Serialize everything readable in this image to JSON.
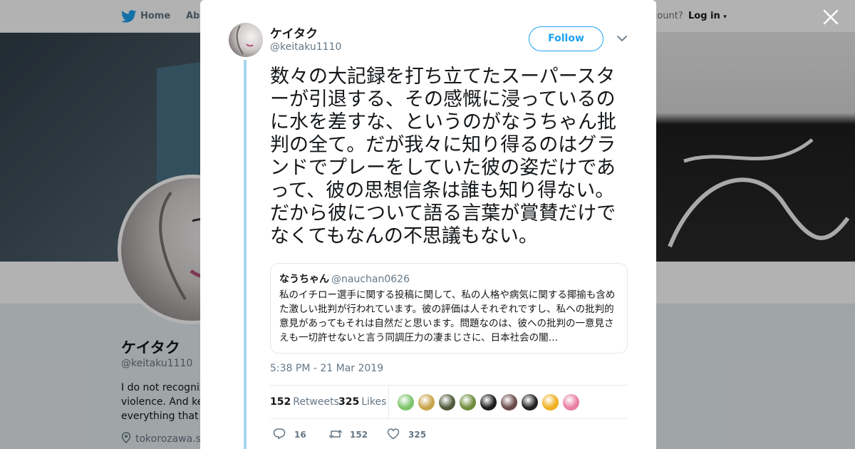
{
  "topbar": {
    "home_label": "Home",
    "about_label": "Abo",
    "have_account": "account?",
    "login_label": "Log in"
  },
  "profile": {
    "name": "ケイタク",
    "handle": "@keitaku1110",
    "bio_lines": [
      "I do not recognize",
      "violence. And kee",
      "everything that ma"
    ],
    "location": "tokorozawa.sa"
  },
  "tweet": {
    "author_name": "ケイタク",
    "author_handle": "@keitaku1110",
    "follow_label": "Follow",
    "text": "数々の大記録を打ち立てたスーパースターが引退する、その感慨に浸っているのに水を差すな、というのがなうちゃん批判の全て。だが我々に知り得るのはグランドでプレーをしていた彼の姿だけであって、彼の思想信条は誰も知り得ない。だから彼について語る言葉が賞賛だけでなくてもなんの不思議もない。",
    "quote": {
      "name": "なうちゃん",
      "handle": "@nauchan0626",
      "text": "私のイチロー選手に関する投稿に関して、私の人格や病気に関する揶揄も含めた激しい批判が行われています。彼の評価は人それぞれですし、私への批判的意見があってもそれは自然だと思います。問題なのは、彼への批判の一意見さえも一切許せないと言う同調圧力の凄まじさに、日本社会の闇…"
    },
    "timestamp": "5:38 PM - 21 Mar 2019",
    "retweets_count": "152",
    "retweets_label": "Retweets",
    "likes_count": "325",
    "likes_label": "Likes",
    "liker_colors": [
      "#7cc46a",
      "#c9a34a",
      "#4f5a3a",
      "#6f8c3c",
      "#1c1c1c",
      "#6a4a4a",
      "#222222",
      "#f0b020",
      "#e87fa0"
    ],
    "actions": {
      "reply_count": "16",
      "retweet_count": "152",
      "like_count": "325"
    }
  },
  "colors": {
    "accent": "#1da1f2",
    "thread_line": "#a8d4f0",
    "muted": "#657786"
  }
}
